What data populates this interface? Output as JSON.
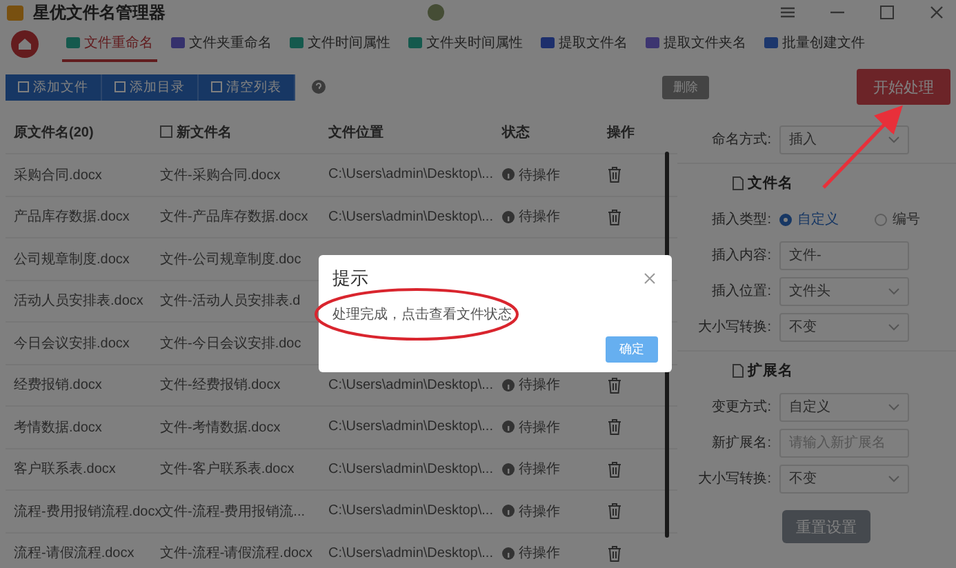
{
  "window": {
    "title": "星优文件名管理器"
  },
  "tabs": [
    {
      "label": "文件重命名",
      "selected": true
    },
    {
      "label": "文件夹重命名",
      "selected": false
    },
    {
      "label": "文件时间属性",
      "selected": false
    },
    {
      "label": "文件夹时间属性",
      "selected": false
    },
    {
      "label": "提取文件名",
      "selected": false
    },
    {
      "label": "提取文件夹名",
      "selected": false
    },
    {
      "label": "批量创建文件",
      "selected": false
    }
  ],
  "toolbar": {
    "buttons": [
      "添加文件",
      "添加目录",
      "清空列表"
    ],
    "delete_button": "删除",
    "start_button": "开始处理"
  },
  "table": {
    "columns": [
      "原文件名(20)",
      "新文件名",
      "文件位置",
      "状态",
      "操作"
    ],
    "rows": [
      {
        "original": "采购合同.docx",
        "new_name": "文件-采购合同.docx",
        "location": "C:\\Users\\admin\\Desktop\\...",
        "status": "待操作"
      },
      {
        "original": "产品库存数据.docx",
        "new_name": "文件-产品库存数据.docx",
        "location": "C:\\Users\\admin\\Desktop\\...",
        "status": "待操作"
      },
      {
        "original": "公司规章制度.docx",
        "new_name": "文件-公司规章制度.doc"
      },
      {
        "original": "活动人员安排表.docx",
        "new_name": "文件-活动人员安排表.d"
      },
      {
        "original": "今日会议安排.docx",
        "new_name": "文件-今日会议安排.doc"
      },
      {
        "original": "经费报销.docx",
        "new_name": "文件-经费报销.docx",
        "location": "C:\\Users\\admin\\Desktop\\...",
        "status": "待操作"
      },
      {
        "original": "考情数据.docx",
        "new_name": "文件-考情数据.docx",
        "location": "C:\\Users\\admin\\Desktop\\...",
        "status": "待操作"
      },
      {
        "original": "客户联系表.docx",
        "new_name": "文件-客户联系表.docx",
        "location": "C:\\Users\\admin\\Desktop\\...",
        "status": "待操作"
      },
      {
        "original": "流程-费用报销流程.docx",
        "new_name": "文件-流程-费用报销流...",
        "location": "C:\\Users\\admin\\Desktop\\...",
        "status": "待操作"
      },
      {
        "original": "流程-请假流程.docx",
        "new_name": "文件-流程-请假流程.docx",
        "location": "C:\\Users\\admin\\Desktop\\...",
        "status": "待操作"
      }
    ]
  },
  "settings": {
    "items": [
      {
        "kind": "select",
        "label": "命名方式:",
        "value": "插入"
      },
      {
        "kind": "section",
        "label": "文件名"
      },
      {
        "kind": "radio",
        "label": "插入类型:",
        "options": [
          {
            "label": "自定义",
            "selected": true
          },
          {
            "label": "编号",
            "selected": false
          }
        ]
      },
      {
        "kind": "input",
        "label": "插入内容:",
        "value": "文件-"
      },
      {
        "kind": "select",
        "label": "插入位置:",
        "value": "文件头"
      },
      {
        "kind": "select",
        "label": "大小写转换:",
        "value": "不变"
      },
      {
        "kind": "section",
        "label": "扩展名"
      },
      {
        "kind": "select",
        "label": "变更方式:",
        "value": "自定义"
      },
      {
        "kind": "input",
        "label": "新扩展名:",
        "placeholder": "请输入新扩展名"
      },
      {
        "kind": "select",
        "label": "大小写转换:",
        "value": "不变"
      }
    ],
    "reset_button": "重置设置"
  },
  "dialog": {
    "title": "提示",
    "message": "处理完成，点击查看文件状态",
    "confirm": "确定"
  }
}
